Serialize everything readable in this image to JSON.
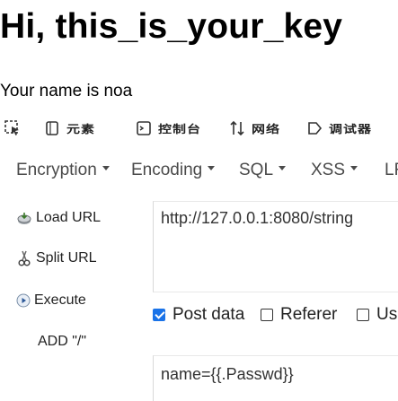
{
  "page": {
    "title": "Hi, this_is_your_key",
    "name_line": "Your name is noa"
  },
  "toolbar": {
    "items": [
      {
        "icon": "cursor-select-icon",
        "label": ""
      },
      {
        "icon": "cube-icon",
        "label": "元素"
      },
      {
        "icon": "console-icon",
        "label": "控制台"
      },
      {
        "icon": "network-icon",
        "label": "网络"
      },
      {
        "icon": "debugger-icon",
        "label": "调试器"
      }
    ]
  },
  "menu": {
    "items": [
      "Encryption",
      "Encoding",
      "SQL",
      "XSS",
      "LF"
    ]
  },
  "actions": {
    "load_url": "Load URL",
    "split_url": "Split URL",
    "execute": "Execute",
    "add_slash": "ADD \"/\""
  },
  "url": {
    "value": "http://127.0.0.1:8080/string"
  },
  "options": {
    "post_data": {
      "label": "Post data",
      "checked": true
    },
    "referer": {
      "label": "Referer",
      "checked": false
    },
    "user_agent": {
      "label": "Us",
      "checked": false
    }
  },
  "post": {
    "value": "name={{.Passwd}}"
  },
  "colors": {
    "accent": "#1a73e8",
    "menu_text": "#4a4a4a"
  }
}
